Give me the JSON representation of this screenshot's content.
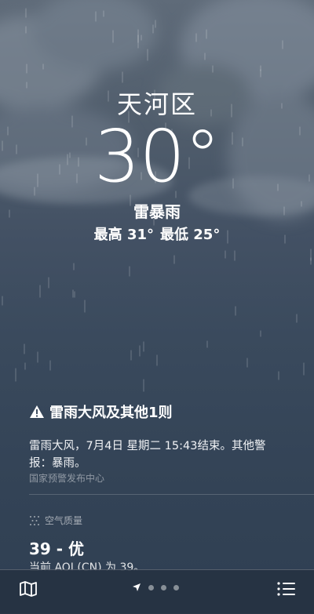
{
  "location": {
    "city": "天河区",
    "temperature": "30°",
    "condition": "雷暴雨",
    "high": "最高 31°",
    "low": "最低 25°"
  },
  "alert": {
    "title": "雷雨大风及其他1则",
    "text": "雷雨大风，7月4日 星期二 15:43结束。其他警报：暴雨。",
    "source": "国家预警发布中心"
  },
  "air_quality": {
    "header": "空气质量",
    "value": "39 - 优",
    "description": "当前 AQI (CN) 为 39。"
  },
  "tabbar": {
    "icons": [
      "map-icon",
      "location-arrow-icon",
      "list-icon"
    ],
    "page_dots": 3
  },
  "colors": {
    "background_top": "#5f6b79",
    "background_bottom": "#2f3f52",
    "text": "#ffffff"
  }
}
